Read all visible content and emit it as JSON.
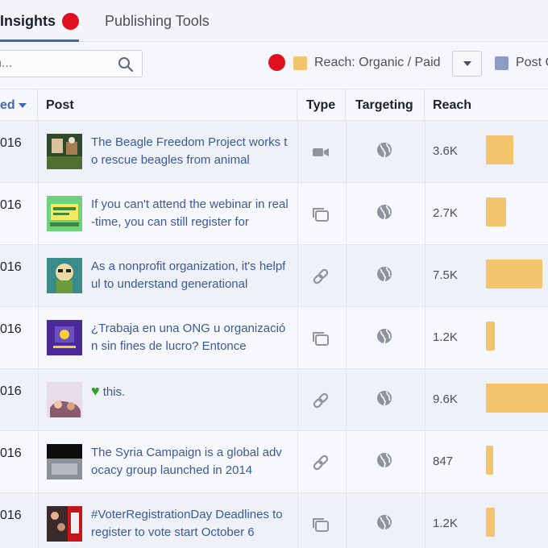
{
  "tabs": {
    "insights_label": "Insights",
    "publishing_label": "Publishing Tools"
  },
  "toolbar": {
    "search_placeholder": "h...",
    "legend_reach_label": "Reach: Organic / Paid",
    "legend_second_label": "Post C"
  },
  "colors": {
    "accent": "#4267b2",
    "reach_bar": "#f2c46e",
    "notification_red": "#e0101e",
    "link_text": "#3b5998"
  },
  "table": {
    "headers": {
      "published": "ed",
      "post": "Post",
      "type": "Type",
      "targeting": "Targeting",
      "reach": "Reach"
    },
    "max_reach": 9.6,
    "rows": [
      {
        "date": "016",
        "post": "The Beagle Freedom Project works to rescue beagles from animal",
        "type_icon": "video-icon",
        "targeting_icon": "globe-icon",
        "reach": "3.6K",
        "reach_value": 3.6,
        "thumb": "beagle"
      },
      {
        "date": "016",
        "post": "If you can't attend the webinar in real-time, you can still register for",
        "type_icon": "photo-icon",
        "targeting_icon": "globe-icon",
        "reach": "2.7K",
        "reach_value": 2.7,
        "thumb": "webinar"
      },
      {
        "date": "016",
        "post": "As a nonprofit organization, it's helpful to understand generational",
        "type_icon": "link-icon",
        "targeting_icon": "globe-icon",
        "reach": "7.5K",
        "reach_value": 7.5,
        "thumb": "cartoon"
      },
      {
        "date": "016",
        "post": "¿Trabaja en una ONG u organización sin fines de lucro? Entonce",
        "type_icon": "photo-icon",
        "targeting_icon": "globe-icon",
        "reach": "1.2K",
        "reach_value": 1.2,
        "thumb": "purple"
      },
      {
        "date": "016",
        "post": "this.",
        "heart": true,
        "type_icon": "link-icon",
        "targeting_icon": "globe-icon",
        "reach": "9.6K",
        "reach_value": 9.6,
        "thumb": "hands"
      },
      {
        "date": "016",
        "post": "The Syria Campaign is a global advocacy group launched in 2014",
        "type_icon": "link-icon",
        "targeting_icon": "globe-icon",
        "reach": "847",
        "reach_value": 0.847,
        "thumb": "syria"
      },
      {
        "date": "016",
        "post": "#VoterRegistrationDay Deadlines to register to vote start October 6",
        "type_icon": "photo-icon",
        "targeting_icon": "globe-icon",
        "reach": "1.2K",
        "reach_value": 1.2,
        "thumb": "voter"
      }
    ]
  }
}
